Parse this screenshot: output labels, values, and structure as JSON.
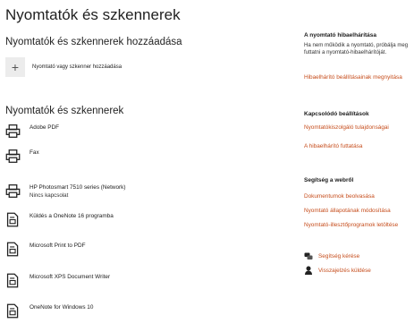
{
  "page": {
    "title": "Nyomtatók és szkennerek"
  },
  "add_section": {
    "title": "Nyomtatók és szkennerek hozzáadása",
    "button_label": "Nyomtató vagy szkenner hozzáadása"
  },
  "devices_section": {
    "title": "Nyomtatók és szkennerek",
    "items": [
      {
        "name": "Adobe PDF",
        "icon": "printer-icon"
      },
      {
        "name": "Fax",
        "icon": "printer-icon"
      },
      {
        "name": "HP Photosmart 7510 series (Network)",
        "status": "Nincs kapcsolat",
        "icon": "printer-icon"
      },
      {
        "name": "Küldés a OneNote 16 programba",
        "icon": "document-printer-icon"
      },
      {
        "name": "Microsoft Print to PDF",
        "icon": "document-printer-icon"
      },
      {
        "name": "Microsoft XPS Document Writer",
        "icon": "document-printer-icon"
      },
      {
        "name": "OneNote for Windows 10",
        "icon": "document-printer-icon"
      }
    ]
  },
  "right_panel": {
    "troubleshoot": {
      "heading": "A nyomtató hibaelhárítása",
      "text": "Ha nem működik a nyomtató, próbálja meg futtatni a nyomtató-hibaelhárítóját.",
      "link": "Hibaelhárító beállításainak megnyitása"
    },
    "related": {
      "heading": "Kapcsolódó beállítások",
      "links": [
        "Nyomtatókiszolgáló tulajdonságai",
        "A hibaelhárító futtatása"
      ]
    },
    "help": {
      "heading": "Segítség a webről",
      "links": [
        "Dokumentumok beolvasása",
        "Nyomtató állapotának módosítása",
        "Nyomtató-illesztőprogramok letöltése"
      ]
    },
    "support": [
      {
        "label": "Segítség kérése",
        "icon": "help-chat-icon"
      },
      {
        "label": "Visszajelzés küldése",
        "icon": "feedback-icon"
      }
    ]
  },
  "colors": {
    "link": "#c64d1c",
    "text": "#1a1a1a",
    "add_button_bg": "#ececec"
  }
}
